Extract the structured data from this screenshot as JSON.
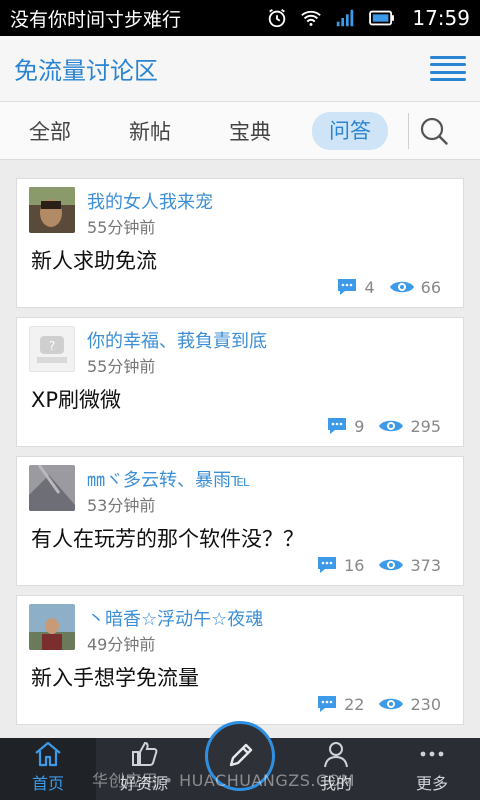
{
  "status_bar": {
    "message": "没有你时间寸步难行",
    "time": "17:59"
  },
  "header": {
    "title": "免流量讨论区"
  },
  "tabs": [
    {
      "label": "全部"
    },
    {
      "label": "新帖"
    },
    {
      "label": "宝典"
    },
    {
      "label": "问答"
    }
  ],
  "posts": [
    {
      "user": "我的女人我来宠",
      "time": "55分钟前",
      "title": "新人求助免流",
      "comments": "4",
      "views": "66"
    },
    {
      "user": "你的幸福、莪負責到底",
      "time": "55分钟前",
      "title": "XP刷微微",
      "comments": "9",
      "views": "295"
    },
    {
      "user": "㎜ヾ多云转、暴雨℡",
      "time": "53分钟前",
      "title": "有人在玩芳的那个软件没？？",
      "comments": "16",
      "views": "373"
    },
    {
      "user": "丶暗香☆浮动午☆夜魂",
      "time": "49分钟前",
      "title": "新入手想学免流量",
      "comments": "22",
      "views": "230"
    }
  ],
  "bottom_nav": {
    "home": "首页",
    "resources": "好资源",
    "mine": "我的",
    "more": "更多"
  },
  "watermark": "华创应用 • HUACHUANGZS.COM",
  "colors": {
    "accent": "#2b84d1",
    "nav_bg": "#2a2d33"
  }
}
